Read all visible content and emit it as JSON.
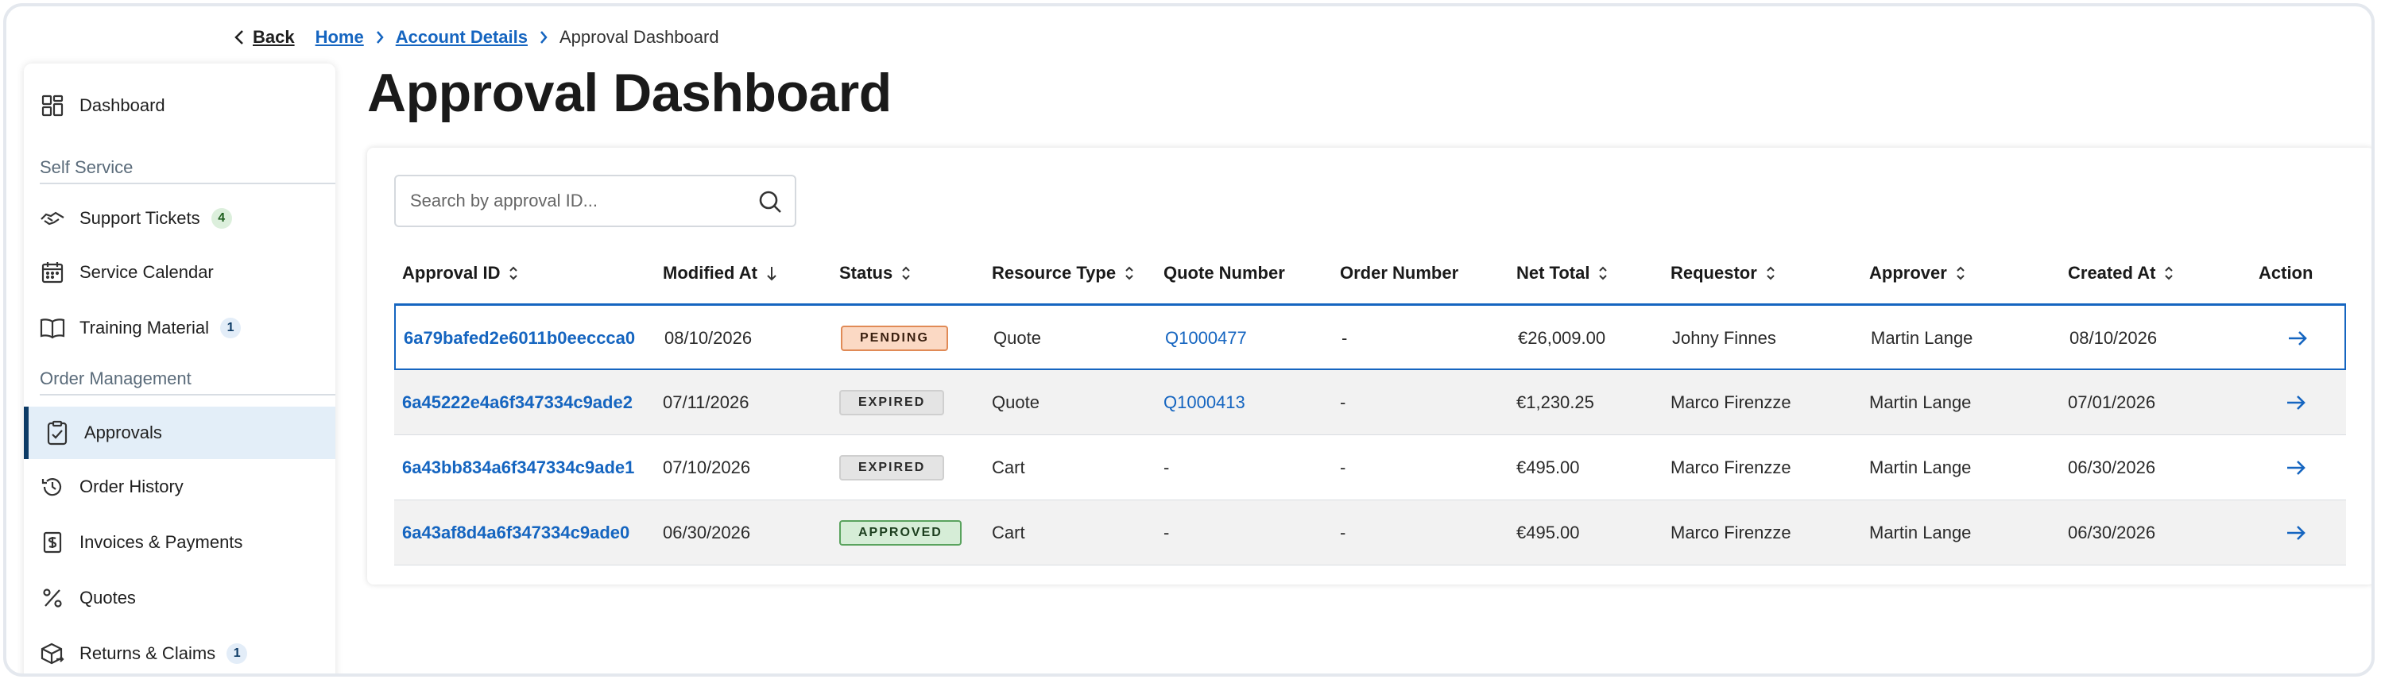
{
  "breadcrumb": {
    "back": "Back",
    "home": "Home",
    "account": "Account Details",
    "current": "Approval Dashboard"
  },
  "sidebar": {
    "items": [
      {
        "label": "Dashboard",
        "icon": "grid-icon"
      },
      {
        "label": "Support Tickets",
        "icon": "handshake-icon",
        "badge": "4"
      },
      {
        "label": "Service Calendar",
        "icon": "calendar-icon"
      },
      {
        "label": "Training Material",
        "icon": "book-icon",
        "badge": "1"
      },
      {
        "label": "Approvals",
        "icon": "clipboard-check-icon"
      },
      {
        "label": "Order History",
        "icon": "history-icon"
      },
      {
        "label": "Invoices & Payments",
        "icon": "invoice-icon"
      },
      {
        "label": "Quotes",
        "icon": "percent-icon"
      },
      {
        "label": "Returns & Claims",
        "icon": "box-return-icon",
        "badge": "1"
      }
    ],
    "sections": {
      "self_service": "Self Service",
      "order_management": "Order Management"
    },
    "active": "Approvals"
  },
  "page": {
    "title": "Approval Dashboard"
  },
  "search": {
    "placeholder": "Search by approval ID..."
  },
  "table": {
    "headers": [
      "Approval ID",
      "Modified At",
      "Status",
      "Resource Type",
      "Quote Number",
      "Order Number",
      "Net Total",
      "Requestor",
      "Approver",
      "Created At",
      "Action"
    ],
    "rows": [
      {
        "id": "6a79bafed2e6011b0eeccca0",
        "modified": "08/10/2026",
        "status": "PENDING",
        "resource": "Quote",
        "quote": "Q1000477",
        "order": "-",
        "total": "€26,009.00",
        "requestor": "Johny Finnes",
        "approver": "Martin Lange",
        "created": "08/10/2026"
      },
      {
        "id": "6a45222e4a6f347334c9ade2",
        "modified": "07/11/2026",
        "status": "EXPIRED",
        "resource": "Quote",
        "quote": "Q1000413",
        "order": "-",
        "total": "€1,230.25",
        "requestor": "Marco Firenzze",
        "approver": "Martin Lange",
        "created": "07/01/2026"
      },
      {
        "id": "6a43bb834a6f347334c9ade1",
        "modified": "07/10/2026",
        "status": "EXPIRED",
        "resource": "Cart",
        "quote": "-",
        "order": "-",
        "total": "€495.00",
        "requestor": "Marco Firenzze",
        "approver": "Martin Lange",
        "created": "06/30/2026"
      },
      {
        "id": "6a43af8d4a6f347334c9ade0",
        "modified": "06/30/2026",
        "status": "APPROVED",
        "resource": "Cart",
        "quote": "-",
        "order": "-",
        "total": "€495.00",
        "requestor": "Marco Firenzze",
        "approver": "Martin Lange",
        "created": "06/30/2026"
      }
    ]
  },
  "colors": {
    "link": "#1565c0",
    "active_bg": "#e3eef8",
    "pending": "#fbd9c4",
    "expired": "#e4e4e4",
    "approved": "#d6edd7"
  }
}
